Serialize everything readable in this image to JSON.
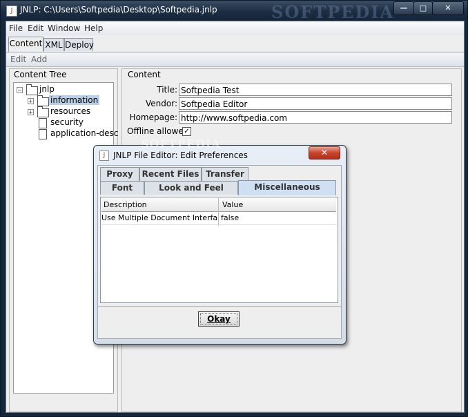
{
  "window": {
    "title": "JNLP: C:\\Users\\Softpedia\\Desktop\\Softpedia.jnlp",
    "watermark": "SOFTPEDIA",
    "minimize_icon": "minimize-icon",
    "maximize_icon": "maximize-icon",
    "close_icon": "close-icon",
    "minimize_glyph": "—",
    "maximize_glyph": "□",
    "close_glyph": "✕"
  },
  "menubar": {
    "items": [
      "File",
      "Edit",
      "Window",
      "Help"
    ]
  },
  "main_tabs": [
    {
      "label": "Content",
      "active": true
    },
    {
      "label": "XML",
      "active": false
    },
    {
      "label": "Deploy",
      "active": false
    }
  ],
  "subtoolbar": {
    "items": [
      "Edit",
      "Add"
    ]
  },
  "content_tree": {
    "title": "Content Tree",
    "root": "jnlp",
    "nodes": [
      {
        "label": "information",
        "selected": true,
        "expandable": true,
        "icon": "folder-icon"
      },
      {
        "label": "resources",
        "selected": false,
        "expandable": true,
        "icon": "folder-icon"
      },
      {
        "label": "security",
        "selected": false,
        "expandable": false,
        "icon": "file-icon"
      },
      {
        "label": "application-desc",
        "selected": false,
        "expandable": false,
        "icon": "file-icon"
      }
    ]
  },
  "content_panel": {
    "title": "Content",
    "fields": [
      {
        "label": "Title:",
        "value": "Softpedia Test"
      },
      {
        "label": "Vendor:",
        "value": "Softpedia Editor"
      },
      {
        "label": "Homepage:",
        "value": "http://www.softpedia.com"
      }
    ],
    "offline": {
      "label": "Offline allowed:",
      "checked": true,
      "check_glyph": "✓"
    }
  },
  "dialog": {
    "title": "JNLP File Editor: Edit Preferences",
    "watermark": "SOFTPEDIA",
    "close_icon": "close-icon",
    "close_glyph": "✕",
    "tabs_row1": [
      "Proxy",
      "Recent Files",
      "Transfer"
    ],
    "tabs_row2": [
      {
        "label": "Font",
        "active": false
      },
      {
        "label": "Look and Feel",
        "active": false
      },
      {
        "label": "Miscellaneous",
        "active": true
      }
    ],
    "table": {
      "columns": [
        "Description",
        "Value"
      ],
      "rows": [
        [
          "Use Multiple Document Interface…",
          "false"
        ]
      ]
    },
    "ok_label": "Okay"
  },
  "colors": {
    "titlebar": "#1d2e42",
    "selection": "#b8cfe5",
    "active_tab": "#cfe0f2",
    "close_button": "#c8442c"
  }
}
